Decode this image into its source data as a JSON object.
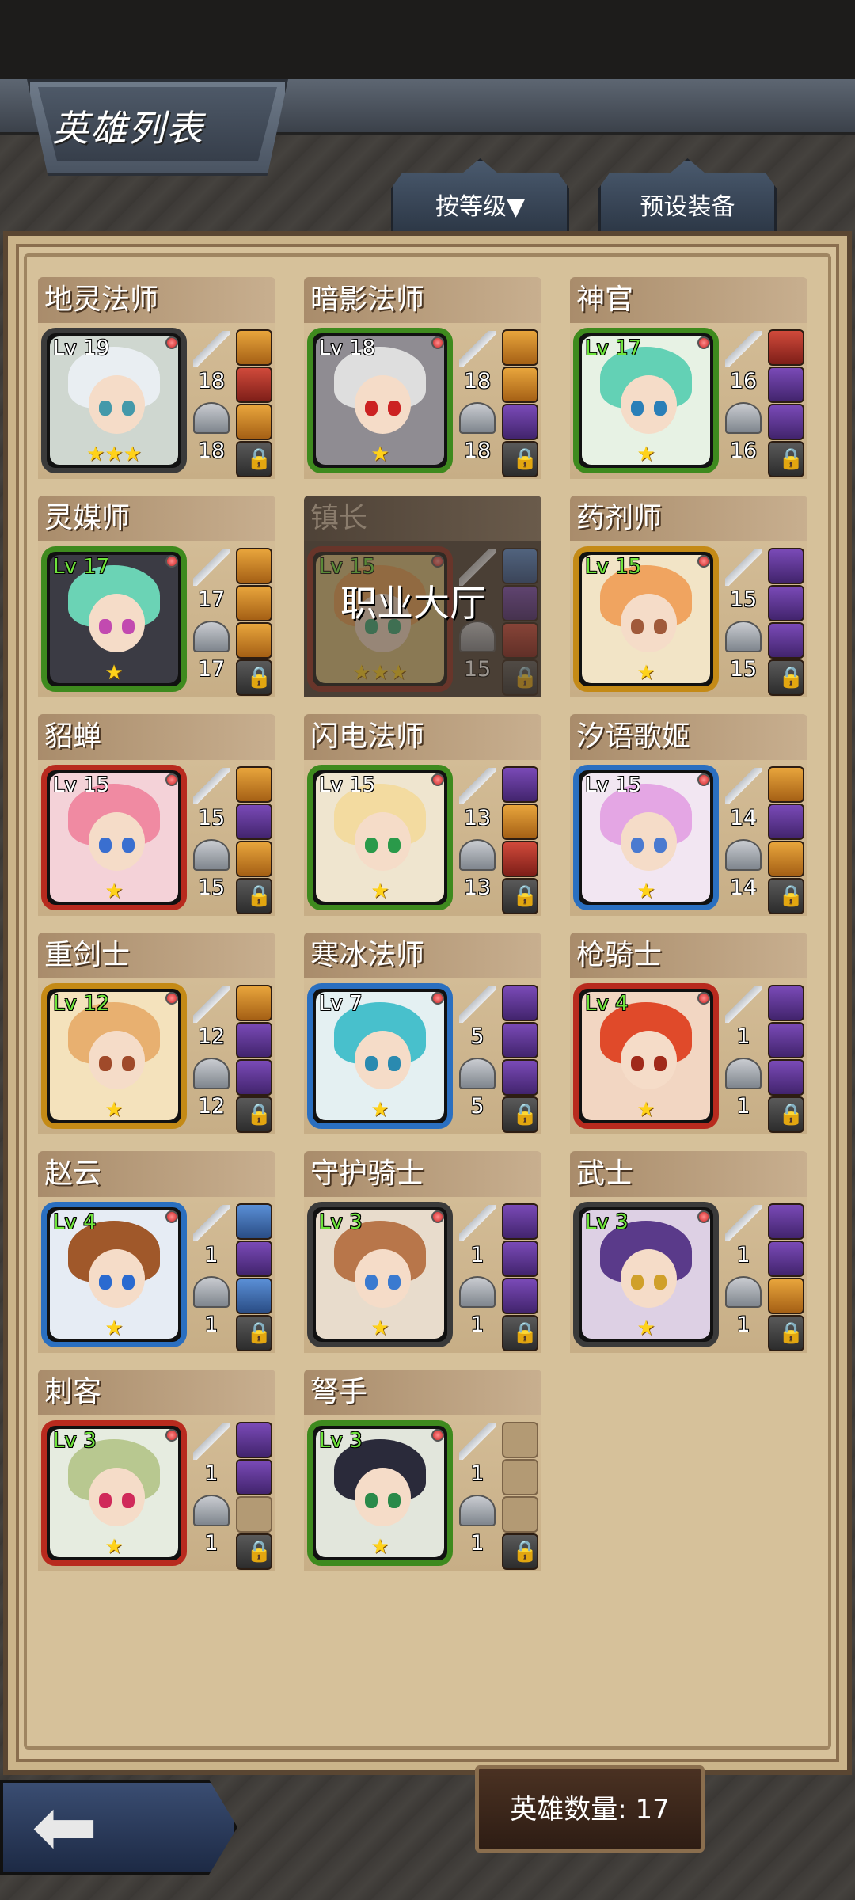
{
  "header": {
    "title": "英雄列表"
  },
  "tabs": [
    {
      "label": "按等级▼"
    },
    {
      "label": "预设装备"
    }
  ],
  "heroes": [
    {
      "name": "地灵法师",
      "level": "Lv 19",
      "lv_color": "white",
      "frame": "#3a3a3a",
      "hair": "#e9eef2",
      "eyes": "#49a",
      "bg": "#cfd7d0",
      "stars": "★★★",
      "atk": "18",
      "def": "18",
      "slots": [
        "gold",
        "red",
        "gold",
        "lock"
      ]
    },
    {
      "name": "暗影法师",
      "level": "Lv 18",
      "lv_color": "white",
      "frame": "#3e8a1e",
      "hair": "#dedede",
      "eyes": "#c22",
      "bg": "#8f8c92",
      "stars": "★",
      "atk": "18",
      "def": "18",
      "slots": [
        "gold",
        "gold",
        "purple",
        "lock"
      ]
    },
    {
      "name": "神官",
      "level": "Lv 17",
      "lv_color": "green",
      "frame": "#3e8a1e",
      "hair": "#63d1b5",
      "eyes": "#2a7fb8",
      "bg": "#e7f2e4",
      "stars": "★",
      "atk": "16",
      "def": "16",
      "slots": [
        "red",
        "purple",
        "purple",
        "lock"
      ]
    },
    {
      "name": "灵媒师",
      "level": "Lv 17",
      "lv_color": "green",
      "frame": "#3e8a1e",
      "hair": "#6bd3b5",
      "eyes": "#c24ab0",
      "bg": "#3b3b44",
      "stars": "★",
      "atk": "17",
      "def": "17",
      "slots": [
        "gold",
        "gold",
        "gold",
        "lock"
      ]
    },
    {
      "name": "镇长",
      "level": "Lv 15",
      "lv_color": "green",
      "frame": "#8e2a1e",
      "hair": "#e8a050",
      "eyes": "#3a7",
      "bg": "#d8c07a",
      "stars": "★★★",
      "atk": "",
      "def": "15",
      "slots": [
        "blue",
        "purple",
        "red",
        "lock"
      ],
      "dim": true,
      "overlay": "职业大厅"
    },
    {
      "name": "药剂师",
      "level": "Lv 15",
      "lv_color": "green",
      "frame": "#c48a16",
      "hair": "#f0a460",
      "eyes": "#a05a3a",
      "bg": "#f2e4c6",
      "stars": "★",
      "atk": "15",
      "def": "15",
      "slots": [
        "purple",
        "purple",
        "purple",
        "lock"
      ]
    },
    {
      "name": "貂蝉",
      "level": "Lv 15",
      "lv_color": "white",
      "frame": "#b82a1e",
      "hair": "#f08aa2",
      "eyes": "#3a6fd0",
      "bg": "#f4d2d8",
      "stars": "★",
      "atk": "15",
      "def": "15",
      "slots": [
        "gold",
        "purple",
        "gold",
        "lock"
      ]
    },
    {
      "name": "闪电法师",
      "level": "Lv 15",
      "lv_color": "white",
      "frame": "#3e8a1e",
      "hair": "#f3dba0",
      "eyes": "#2a9a4a",
      "bg": "#efe5cf",
      "stars": "★",
      "atk": "13",
      "def": "13",
      "slots": [
        "purple",
        "gold",
        "red",
        "lock"
      ]
    },
    {
      "name": "汐语歌姬",
      "level": "Lv 15",
      "lv_color": "white",
      "frame": "#2a6fc0",
      "hair": "#e4a6e4",
      "eyes": "#4a7ad0",
      "bg": "#f2e6f2",
      "stars": "★",
      "atk": "14",
      "def": "14",
      "slots": [
        "gold",
        "purple",
        "gold",
        "lock"
      ]
    },
    {
      "name": "重剑士",
      "level": "Lv 12",
      "lv_color": "green",
      "frame": "#c48a16",
      "hair": "#e8b070",
      "eyes": "#a04a2a",
      "bg": "#f4e2bc",
      "stars": "★",
      "atk": "12",
      "def": "12",
      "slots": [
        "gold",
        "purple",
        "purple",
        "lock"
      ]
    },
    {
      "name": "寒冰法师",
      "level": "Lv 7",
      "lv_color": "white",
      "frame": "#2a6fc0",
      "hair": "#48c0cc",
      "eyes": "#2a8ab0",
      "bg": "#e4f0f2",
      "stars": "★",
      "atk": "5",
      "def": "5",
      "slots": [
        "purple",
        "purple",
        "purple",
        "lock"
      ]
    },
    {
      "name": "枪骑士",
      "level": "Lv 4",
      "lv_color": "green",
      "frame": "#b82a1e",
      "hair": "#e04a2a",
      "eyes": "#a02a1a",
      "bg": "#f2d6c2",
      "stars": "★",
      "atk": "1",
      "def": "1",
      "slots": [
        "purple",
        "purple",
        "purple",
        "lock"
      ]
    },
    {
      "name": "赵云",
      "level": "Lv 4",
      "lv_color": "green",
      "frame": "#2a6fc0",
      "hair": "#a0582a",
      "eyes": "#2a6ad0",
      "bg": "#e6ecf4",
      "stars": "★",
      "atk": "1",
      "def": "1",
      "slots": [
        "blue",
        "purple",
        "blue",
        "lock"
      ]
    },
    {
      "name": "守护骑士",
      "level": "Lv 3",
      "lv_color": "green",
      "frame": "#3a3a3a",
      "hair": "#b8764a",
      "eyes": "#3a7ad0",
      "bg": "#e8dccc",
      "stars": "★",
      "atk": "1",
      "def": "1",
      "slots": [
        "purple",
        "purple",
        "purple",
        "lock"
      ]
    },
    {
      "name": "武士",
      "level": "Lv 3",
      "lv_color": "green",
      "frame": "#3a3a3a",
      "hair": "#5a3a8a",
      "eyes": "#d0a02a",
      "bg": "#ddd0e4",
      "stars": "★",
      "atk": "1",
      "def": "1",
      "slots": [
        "purple",
        "purple",
        "gold",
        "lock"
      ]
    },
    {
      "name": "刺客",
      "level": "Lv 3",
      "lv_color": "green",
      "frame": "#b82a1e",
      "hair": "#b8c890",
      "eyes": "#d02a5a",
      "bg": "#e6ece0",
      "stars": "★",
      "atk": "1",
      "def": "1",
      "slots": [
        "purple",
        "purple",
        "empty",
        "lock"
      ]
    },
    {
      "name": "弩手",
      "level": "Lv 3",
      "lv_color": "green",
      "frame": "#3e8a1e",
      "hair": "#2a2a3a",
      "eyes": "#2a8a4a",
      "bg": "#e2e6dc",
      "stars": "★",
      "atk": "1",
      "def": "1",
      "slots": [
        "empty",
        "empty",
        "empty",
        "lock"
      ]
    }
  ],
  "footer": {
    "count_label": "英雄数量: 17"
  }
}
